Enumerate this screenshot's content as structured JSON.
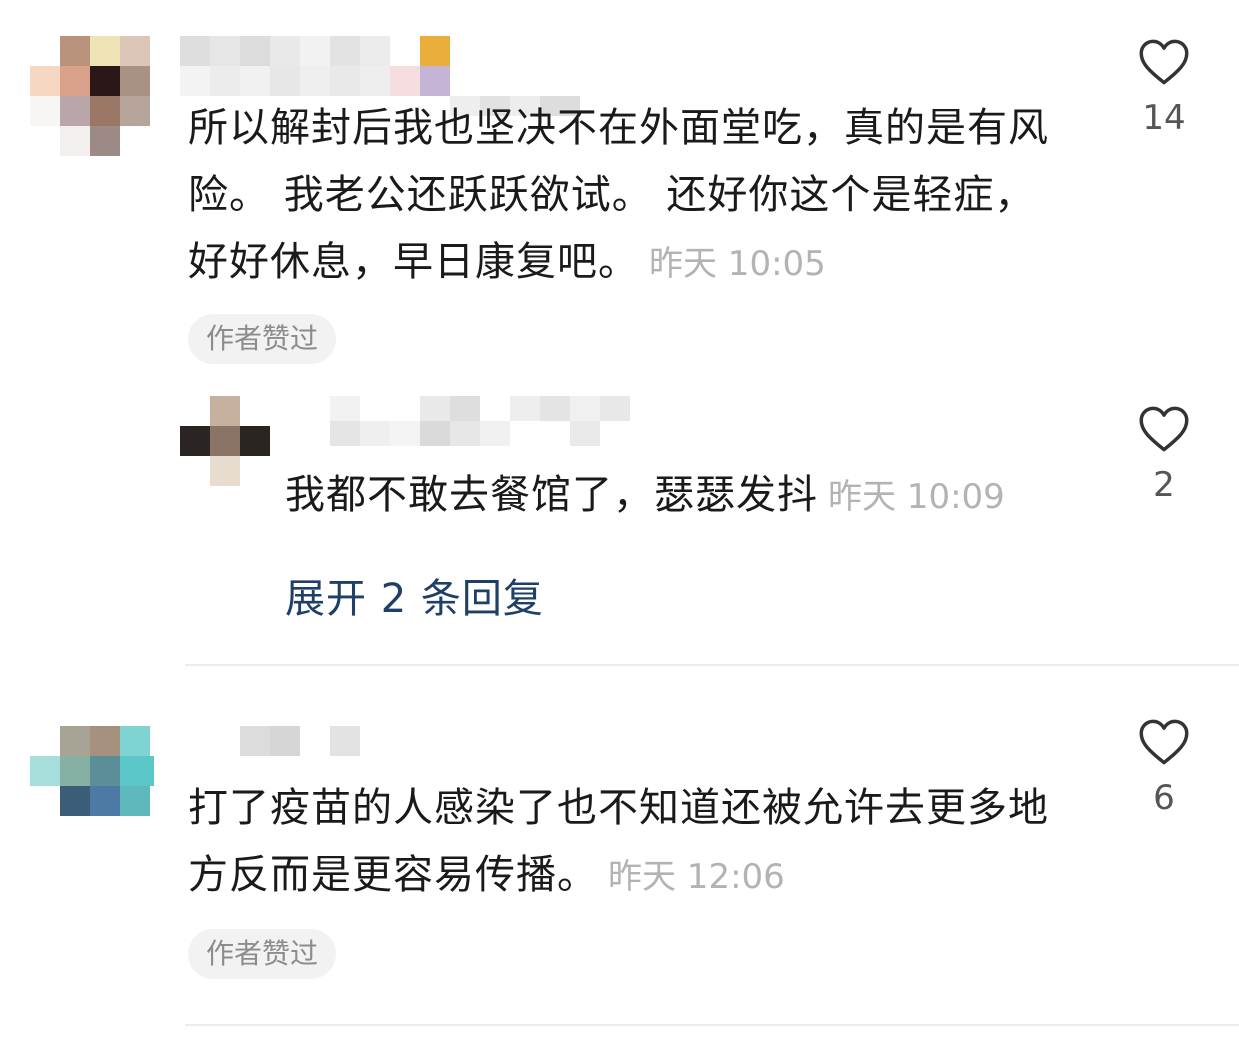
{
  "comments": [
    {
      "text": "所以解封后我也坚决不在外面堂吃，真的是有风险。 我老公还跃跃欲试。 还好你这个是轻症，好好休息，早日康复吧。",
      "time": "昨天 10:05",
      "author_liked": "作者赞过",
      "likes": "14",
      "replies": [
        {
          "text": "我都不敢去餐馆了，瑟瑟发抖",
          "time": "昨天 10:09",
          "likes": "2"
        }
      ],
      "expand_label": "展开 2 条回复"
    },
    {
      "text": "打了疫苗的人感染了也不知道还被允许去更多地方反而是更容易传播。",
      "time": "昨天 12:06",
      "author_liked": "作者赞过",
      "likes": "6"
    }
  ],
  "colors": {
    "text": "#1a1a1a",
    "timestamp": "#b3b3b3",
    "link": "#1f3f66",
    "badge_bg": "#f2f2f2",
    "badge_text": "#8c8c8c"
  },
  "icons": {
    "like": "heart-outline-icon"
  }
}
